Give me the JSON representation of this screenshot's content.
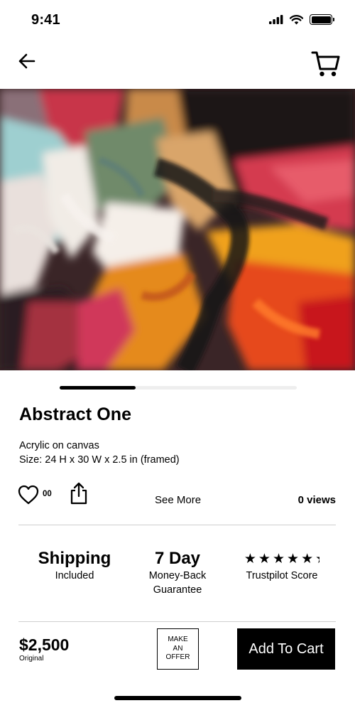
{
  "status_bar": {
    "time": "9:41"
  },
  "nav": {
    "back_icon": "arrow-left-icon",
    "cart_icon": "shopping-cart-icon"
  },
  "product": {
    "image_alt": "Abstract One painting",
    "title": "Abstract One",
    "medium": "Acrylic on canvas",
    "size": "Size: 24 H x 30 W x 2.5 in (framed)",
    "carousel_progress": 0.32
  },
  "actions": {
    "like_count": "00",
    "see_more": "See More",
    "views": "0 views"
  },
  "features": {
    "shipping_title": "Shipping",
    "shipping_sub": "Included",
    "guarantee_title": "7 Day",
    "guarantee_sub_line1": "Money-Back",
    "guarantee_sub_line2": "Guarantee",
    "trustpilot_sub": "Trustpilot Score",
    "trustpilot_stars": 4.2
  },
  "footer": {
    "price": "$2,500",
    "price_label": "Original",
    "offer_line1": "MAKE",
    "offer_line2": "AN",
    "offer_line3": "OFFER",
    "add_to_cart": "Add To Cart"
  },
  "colors": {
    "primary": "#000000",
    "divider": "#cfcfcf",
    "track": "#eeeeee"
  }
}
